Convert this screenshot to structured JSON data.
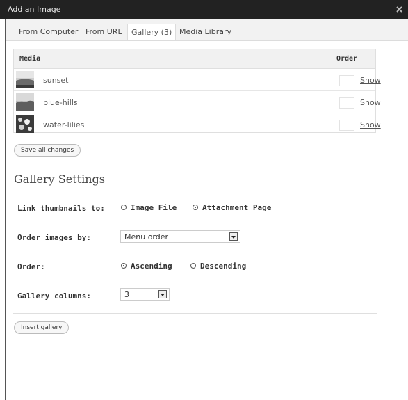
{
  "window": {
    "title": "Add an Image",
    "close_icon": "close-icon"
  },
  "tabs": [
    {
      "label": "From Computer",
      "active": false
    },
    {
      "label": "From URL",
      "active": false
    },
    {
      "label": "Gallery (3)",
      "active": true
    },
    {
      "label": "Media Library",
      "active": false
    }
  ],
  "media_table": {
    "headers": {
      "media": "Media",
      "order": "Order"
    },
    "rows": [
      {
        "name": "sunset",
        "order": "",
        "action": "Show"
      },
      {
        "name": "blue-hills",
        "order": "",
        "action": "Show"
      },
      {
        "name": "water-lilies",
        "order": "",
        "action": "Show"
      }
    ]
  },
  "save_button": "Save all changes",
  "gallery_settings": {
    "title": "Gallery Settings",
    "link_label": "Link thumbnails to:",
    "link_options": [
      "Image File",
      "Attachment Page"
    ],
    "link_selected": "Attachment Page",
    "orderby_label": "Order images by:",
    "orderby_value": "Menu order",
    "order_label": "Order:",
    "order_options": [
      "Ascending",
      "Descending"
    ],
    "order_selected": "Ascending",
    "columns_label": "Gallery columns:",
    "columns_value": "3"
  },
  "insert_button": "Insert gallery",
  "colors": {
    "titlebar": "#222222",
    "tabbar": "#f2f2f2",
    "border": "#dfdfdf"
  }
}
